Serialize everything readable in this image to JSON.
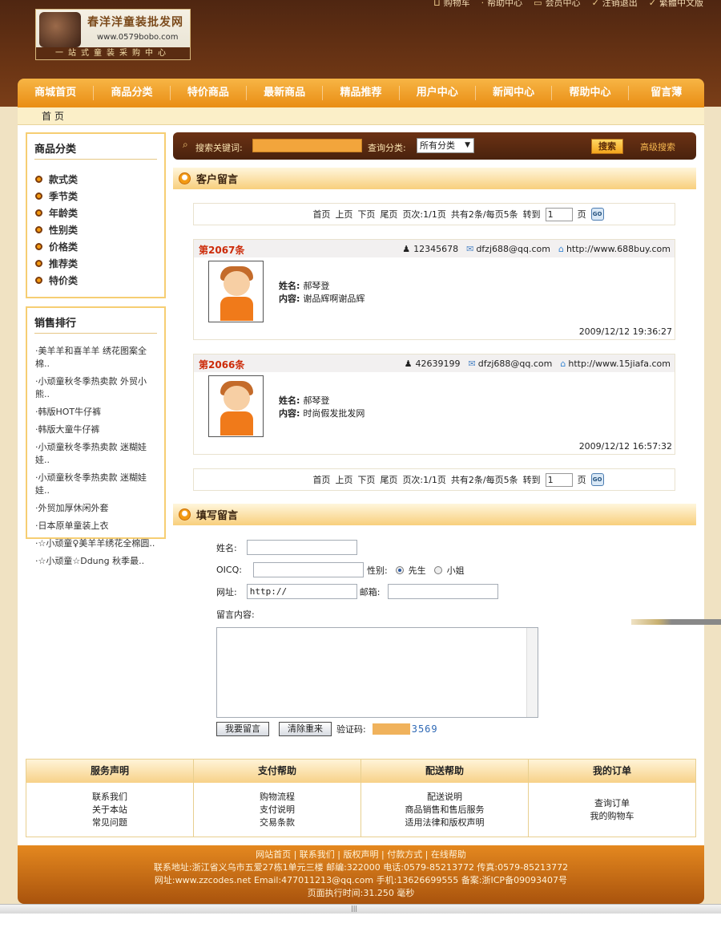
{
  "top_links": [
    "购物车",
    "帮助中心",
    "会员中心",
    "注销退出",
    "繁體中文版"
  ],
  "logo": {
    "title": "春洋洋童装批发网",
    "url": "www.0579bobo.com",
    "slogan": "一站式童装采购中心"
  },
  "nav": [
    "商城首页",
    "商品分类",
    "特价商品",
    "最新商品",
    "精品推荐",
    "用户中心",
    "新闻中心",
    "帮助中心",
    "留言薄"
  ],
  "breadcrumb": "首 页",
  "categories": {
    "title": "商品分类",
    "items": [
      "款式类",
      "季节类",
      "年龄类",
      "性别类",
      "价格类",
      "推荐类",
      "特价类"
    ]
  },
  "ranking": {
    "title": "销售排行",
    "items": [
      "·美羊羊和喜羊羊 绣花图案全棉..",
      "·小顽童秋冬季热卖款 外贸小熊..",
      "·韩版HOT牛仔裤",
      "·韩版大童牛仔裤",
      "·小顽童秋冬季热卖款 迷糊娃娃..",
      "·小顽童秋冬季热卖款 迷糊娃娃..",
      "·外贸加厚休闲外套",
      "·日本原单童装上衣",
      "·☆小顽童♀美羊羊绣花全棉圆..",
      "·☆小顽童☆Ddung 秋季最.."
    ]
  },
  "search": {
    "keyword_label": "搜索关键词:",
    "category_label": "查询分类:",
    "category_value": "所有分类",
    "button": "搜索",
    "advanced": "高级搜索"
  },
  "guestbook": {
    "title": "客户留言",
    "pager": {
      "first": "首页",
      "prev": "上页",
      "next": "下页",
      "last": "尾页",
      "pages": "页次:1/1页",
      "total": "共有2条/每页5条",
      "goto": "转到",
      "page_value": "1",
      "page_unit": "页",
      "go": "GO"
    },
    "messages": [
      {
        "no": "第2067条",
        "qq": "12345678",
        "email": "dfzj688@qq.com",
        "site": "http://www.688buy.com",
        "name_label": "姓名:",
        "name": "郝琴登",
        "content_label": "内容:",
        "content": "谢品辉啊谢品辉",
        "time": "2009/12/12 19:36:27"
      },
      {
        "no": "第2066条",
        "qq": "42639199",
        "email": "dfzj688@qq.com",
        "site": "http://www.15jiafa.com",
        "name_label": "姓名:",
        "name": "郝琴登",
        "content_label": "内容:",
        "content": "时尚假发批发网",
        "time": "2009/12/12 16:57:32"
      }
    ]
  },
  "form": {
    "title": "填写留言",
    "name_label": "姓名:",
    "oicq_label": "OICQ:",
    "gender_label": "性别:",
    "male": "先生",
    "female": "小姐",
    "site_label": "网址:",
    "site_value": "http://",
    "email_label": "邮箱:",
    "content_label": "留言内容:",
    "submit": "我要留言",
    "reset": "清除重来",
    "captcha_label": "验证码:",
    "captcha_code": "3569"
  },
  "footer_columns": [
    {
      "title": "服务声明",
      "links": [
        "联系我们",
        "关于本站",
        "常见问题"
      ]
    },
    {
      "title": "支付帮助",
      "links": [
        "购物流程",
        "支付说明",
        "交易条款"
      ]
    },
    {
      "title": "配送帮助",
      "links": [
        "配送说明",
        "商品销售和售后服务",
        "适用法律和版权声明"
      ]
    },
    {
      "title": "我的订单",
      "links": [
        "查询订单",
        "我的购物车"
      ]
    }
  ],
  "bottom_lines": [
    "网站首页 | 联系我们 | 版权声明 | 付款方式 | 在线帮助",
    "联系地址:浙江省义乌市五爱27栋1单元三楼   邮编:322000 电话:0579-85213772   传真:0579-85213772",
    "网址:www.zzcodes.net Email:477011213@qq.com 手机:13626699555  备案:浙ICP备09093407号",
    "页面执行时间:31.250 毫秒"
  ]
}
